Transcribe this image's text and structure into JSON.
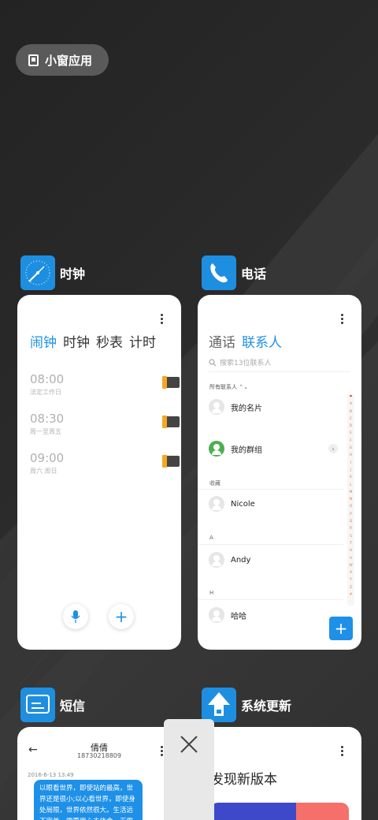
{
  "mini_window_button": {
    "label": "小窗应用"
  },
  "cards": {
    "clock": {
      "app_name": "时钟",
      "tabs": [
        "闹钟",
        "时钟",
        "秒表",
        "计时"
      ],
      "alarms": [
        {
          "time": "08:00",
          "repeat": "法定工作日"
        },
        {
          "time": "08:30",
          "repeat": "周一至周五"
        },
        {
          "time": "09:00",
          "repeat": "周六 周日"
        }
      ],
      "add_symbol": "+"
    },
    "phone": {
      "app_name": "电话",
      "tabs": [
        "通话",
        "联系人"
      ],
      "search_placeholder": "搜索13位联系人",
      "filter_label": "所有联系人 ⌃⌄",
      "rows": {
        "my_card": "我的名片",
        "my_groups": "我的群组",
        "favorites_header": "收藏",
        "nicole": "Nicole",
        "section_a": "A",
        "andy": "Andy",
        "section_h": "H",
        "haha": "哈哈"
      },
      "alphabet": [
        "❤",
        "A",
        "B",
        "C",
        "D",
        "E",
        "F",
        "G",
        "H",
        "I",
        "J",
        "K",
        "L",
        "M",
        "N",
        "O",
        "P",
        "Q",
        "R",
        "S",
        "T",
        "U",
        "V",
        "W",
        "X",
        "Y",
        "Z",
        "#"
      ],
      "fab_symbol": "+"
    },
    "sms": {
      "app_name": "短信",
      "contact_name": "倩倩",
      "contact_number": "18730218809",
      "date": "2016-6-13 13:49",
      "message": "以眼看世界，即使站的最高，世界还是很小;以心看世界，即使身处局限，世界依然很大。生活远不完美，需要用心去体会。无需拥有太多"
    },
    "update": {
      "app_name": "系统更新",
      "heading": "发现新版本"
    }
  },
  "colors": {
    "accent": "#1e90e8",
    "toggle_on": "#f5a623",
    "green": "#4caf50"
  }
}
